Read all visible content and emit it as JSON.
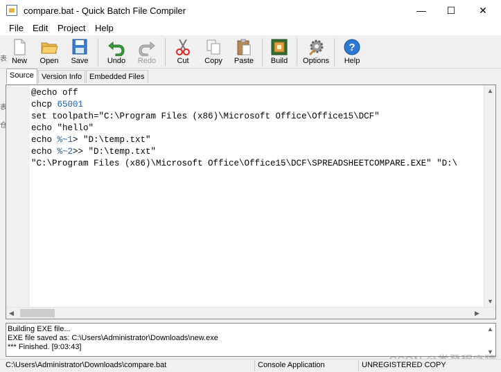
{
  "window": {
    "title": "compare.bat - Quick Batch File Compiler",
    "controls": {
      "minimize": "—",
      "maximize": "☐",
      "close": "✕"
    }
  },
  "menu": [
    "File",
    "Edit",
    "Project",
    "Help"
  ],
  "toolbar": {
    "new": "New",
    "open": "Open",
    "save": "Save",
    "undo": "Undo",
    "redo": "Redo",
    "cut": "Cut",
    "copy": "Copy",
    "paste": "Paste",
    "build": "Build",
    "options": "Options",
    "help": "Help"
  },
  "tabs": [
    "Source",
    "Version Info",
    "Embedded Files"
  ],
  "editor": {
    "lines": [
      "@echo off",
      "chcp 65001",
      "set toolpath=\"C:\\Program Files (x86)\\Microsoft Office\\Office15\\DCF\"",
      "echo \"hello\"",
      "echo %~1> \"D:\\temp.txt\"",
      "echo %~2>> \"D:\\temp.txt\"",
      "\"C:\\Program Files (x86)\\Microsoft Office\\Office15\\DCF\\SPREADSHEETCOMPARE.EXE\" \"D:\\"
    ]
  },
  "output": {
    "lines": [
      "Building EXE file...",
      "EXE file saved as: C:\\Users\\Administrator\\Downloads\\new.exe",
      "*** Finished. [9:03:43]"
    ]
  },
  "status": {
    "path": "C:\\Users\\Administrator\\Downloads\\compare.bat",
    "type": "Console Application",
    "license": "UNREGISTERED COPY"
  },
  "watermark": "CSDN @娄登程序猿",
  "left_edge_text": [
    "表",
    "表",
    "仓"
  ]
}
